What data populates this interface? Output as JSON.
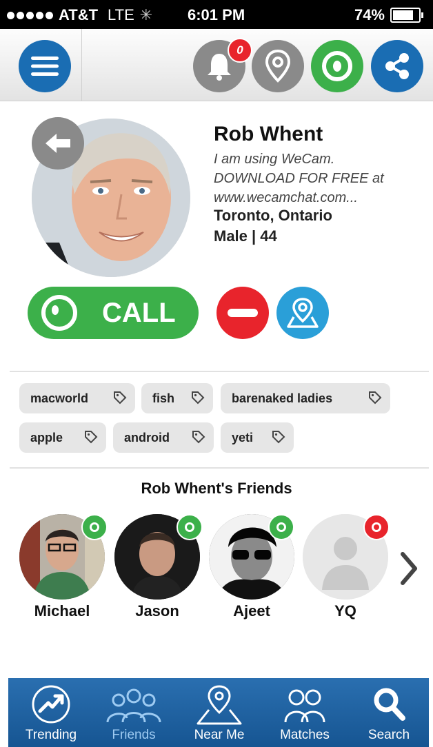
{
  "status_bar": {
    "carrier": "AT&T",
    "network": "LTE",
    "time": "6:01 PM",
    "battery": "74%"
  },
  "toolbar": {
    "notification_count": "0"
  },
  "profile": {
    "name": "Rob Whent",
    "status_line1": "I am using WeCam.",
    "status_line2": "DOWNLOAD FOR FREE at",
    "status_line3": "www.wecamchat.com...",
    "location": "Toronto, Ontario",
    "gender_age": "Male | 44",
    "call_label": "CALL"
  },
  "tags": [
    "macworld",
    "fish",
    "barenaked ladies",
    "apple",
    "android",
    "yeti"
  ],
  "friends_section": {
    "title": "Rob Whent's Friends",
    "friends": [
      {
        "name": "Michael",
        "status": "online"
      },
      {
        "name": "Jason",
        "status": "online"
      },
      {
        "name": "Ajeet",
        "status": "online"
      },
      {
        "name": "YQ",
        "status": "offline"
      }
    ]
  },
  "bottom_nav": [
    {
      "label": "Trending"
    },
    {
      "label": "Friends",
      "active": true
    },
    {
      "label": "Near Me"
    },
    {
      "label": "Matches"
    },
    {
      "label": "Search"
    }
  ],
  "colors": {
    "brand_blue": "#1a6db3",
    "call_green": "#3cb04a",
    "alert_red": "#e8242c",
    "gray_button": "#8a8a8a"
  }
}
